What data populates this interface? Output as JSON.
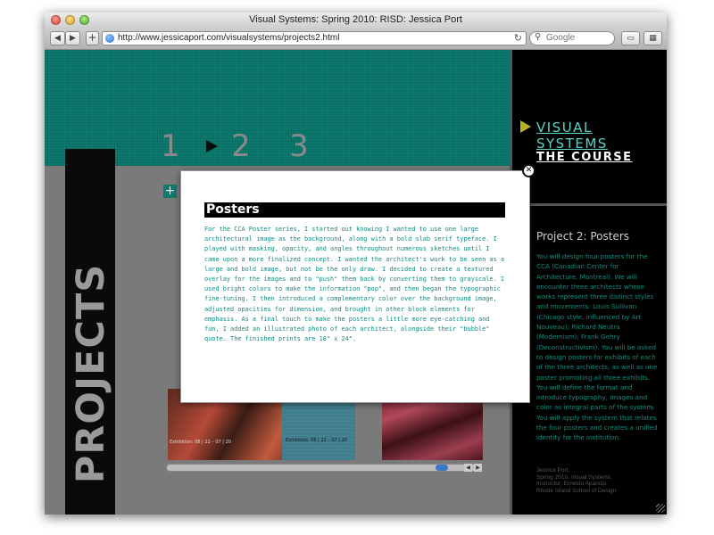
{
  "window": {
    "title": "Visual Systems: Spring 2010: RISD: Jessica Port"
  },
  "toolbar": {
    "back_glyph": "◀",
    "forward_glyph": "▶",
    "add_glyph": "+",
    "url": "http://www.jessicaport.com/visualsystems/projects2.html",
    "reload_glyph": "↻",
    "search_placeholder": "Google",
    "search_icon": "magnifier-icon",
    "bookmarks_icon": "book-icon",
    "topsites_icon": "grid-icon"
  },
  "site_nav": {
    "items": [
      {
        "label": "VISUAL SYSTEMS"
      },
      {
        "label": "THE COURSE"
      }
    ]
  },
  "steps": [
    "1",
    "2",
    "3"
  ],
  "section_label": "PROJECTS",
  "plus_label": "+",
  "project": {
    "title": "Project 2: Posters",
    "description": "You will design four posters for the CCA (Canadian Center for Architecture, Montreal). We will encounter three architects whose works represent three distinct styles and movements: Louis Sullivan (Chicago style, influenced by Art Nouveau); Richard Neutra (Modernism); Frank Gehry (Deconstructivism). You will be asked to design posters for exhibits of each of the three architects, as well as one poster promoting all three exhibits. You will define the format and introduce typography, images and color as integral parts of the system. You will apply the system that relates the four posters and creates a unified identity for the institution.",
    "credits": [
      "Jessica Port.",
      "Spring 2010. Visual Systems.",
      "Instructor: Ernesto Aparicio.",
      "Rhode Island School of Design"
    ]
  },
  "thumbnails": {
    "thumb1_label": "Exhibition: 08 | 22 – 07 | 20",
    "thumb2_label": "Exhibition: 08 | 22 – 07 | 20"
  },
  "modal": {
    "title": "Posters",
    "body": "For the CCA Poster series, I started out knowing I wanted to use one large architectural image as the background, along with a bold slab serif typeface. I played with masking, opacity, and angles throughout numerous sketches until I came upon a more finalized concept. I wanted the architect's work to be seen as a large and bold image, but not be the only draw. I decided to create a textured overlay for the images and to \"push\" them back by converting them to grayscale. I used bright colors to make the information \"pop\", and then began the typographic fine-tuning. I then introduced a complementary color over the background image, adjusted opacities for dimension, and brought in other block elements for emphasis. As a final touch to make the posters a little more eye-catching and fun, I added an illustrated photo of each architect, alongside their \"bubble\" quote. The finished prints are 18\" x 24\".",
    "close_glyph": "✕"
  },
  "colors": {
    "teal": "#0c7a6e",
    "teal_text": "#108a80",
    "nav_arrow": "#b9b020",
    "black": "#000000"
  }
}
